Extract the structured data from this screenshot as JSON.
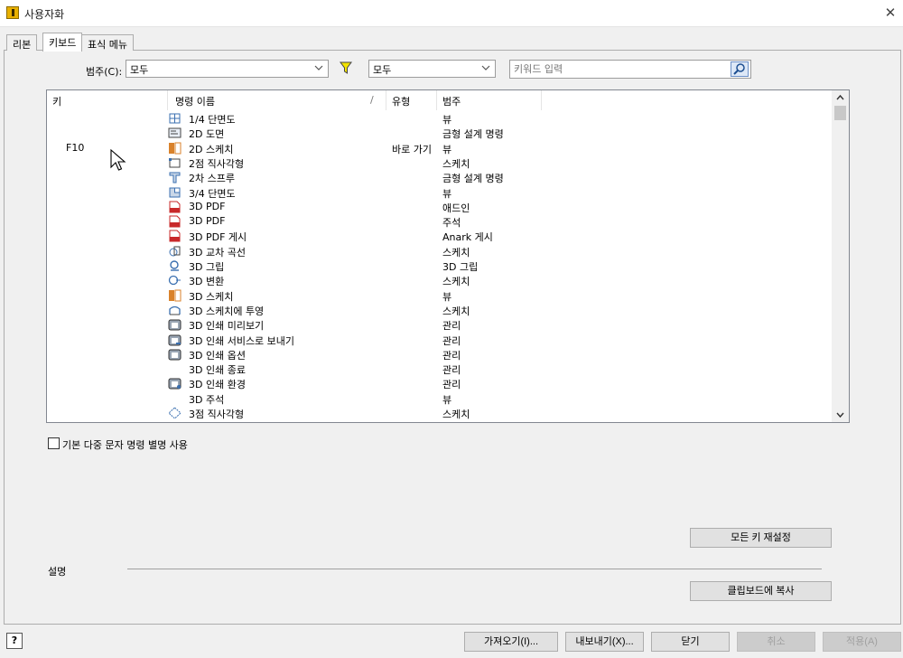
{
  "window": {
    "title": "사용자화"
  },
  "tabs": [
    {
      "label": "리본"
    },
    {
      "label": "키보드"
    },
    {
      "label": "표식 메뉴"
    }
  ],
  "filters": {
    "category_label": "범주(C):",
    "category_value": "모두",
    "filter_value": "모두",
    "search_placeholder": "키워드 입력"
  },
  "list": {
    "columns": [
      "키",
      "명령 이름",
      "/",
      "유형",
      "범주"
    ],
    "rows": [
      {
        "key": "",
        "command": "1/4 단면도",
        "type": "",
        "category": "뷰",
        "icon": "quarter-section-icon"
      },
      {
        "key": "",
        "command": "2D 도면",
        "type": "",
        "category": "금형 설계 명령",
        "icon": "2d-drawing-icon"
      },
      {
        "key": "F10",
        "command": "2D 스케치",
        "type": "바로 가기",
        "category": "뷰",
        "icon": "2d-sketch-icon"
      },
      {
        "key": "",
        "command": "2점 직사각형",
        "type": "",
        "category": "스케치",
        "icon": "two-point-rectangle-icon"
      },
      {
        "key": "",
        "command": "2차 스프루",
        "type": "",
        "category": "금형 설계 명령",
        "icon": "secondary-sprue-icon"
      },
      {
        "key": "",
        "command": "3/4 단면도",
        "type": "",
        "category": "뷰",
        "icon": "three-quarter-section-icon"
      },
      {
        "key": "",
        "command": "3D PDF",
        "type": "",
        "category": "애드인",
        "icon": "pdf-icon"
      },
      {
        "key": "",
        "command": "3D PDF",
        "type": "",
        "category": "주석",
        "icon": "pdf-icon"
      },
      {
        "key": "",
        "command": "3D PDF 게시",
        "type": "",
        "category": "Anark 게시",
        "icon": "pdf-publish-icon"
      },
      {
        "key": "",
        "command": "3D 교차 곡선",
        "type": "",
        "category": "스케치",
        "icon": "intersection-curve-icon"
      },
      {
        "key": "",
        "command": "3D 그립",
        "type": "",
        "category": "3D 그립",
        "icon": "3d-grip-icon"
      },
      {
        "key": "",
        "command": "3D 변환",
        "type": "",
        "category": "스케치",
        "icon": "3d-transform-icon"
      },
      {
        "key": "",
        "command": "3D 스케치",
        "type": "",
        "category": "뷰",
        "icon": "3d-sketch-icon"
      },
      {
        "key": "",
        "command": "3D 스케치에 투영",
        "type": "",
        "category": "스케치",
        "icon": "project-to-3d-sketch-icon"
      },
      {
        "key": "",
        "command": "3D 인쇄 미리보기",
        "type": "",
        "category": "관리",
        "icon": "3d-print-preview-icon"
      },
      {
        "key": "",
        "command": "3D 인쇄 서비스로 보내기",
        "type": "",
        "category": "관리",
        "icon": "3d-print-send-icon"
      },
      {
        "key": "",
        "command": "3D 인쇄 옵션",
        "type": "",
        "category": "관리",
        "icon": "3d-print-options-icon"
      },
      {
        "key": "",
        "command": "3D 인쇄 종료",
        "type": "",
        "category": "관리",
        "icon": ""
      },
      {
        "key": "",
        "command": "3D 인쇄 환경",
        "type": "",
        "category": "관리",
        "icon": "3d-print-env-icon"
      },
      {
        "key": "",
        "command": "3D 주석",
        "type": "",
        "category": "뷰",
        "icon": ""
      },
      {
        "key": "",
        "command": "3점 직사각형",
        "type": "",
        "category": "스케치",
        "icon": "three-point-rectangle-icon"
      }
    ]
  },
  "checkbox": {
    "label": "기본 다중 문자 명령 별명 사용"
  },
  "buttons": {
    "reset_all": "모든 키 재설정",
    "copy_clipboard": "클립보드에 복사",
    "import": "가져오기(I)...",
    "export": "내보내기(X)...",
    "close": "닫기",
    "cancel": "취소",
    "apply": "적용(A)",
    "help": "?"
  },
  "description": {
    "label": "설명"
  },
  "colors": {
    "accent": "#e8b000",
    "filter_funnel": "#d4c000",
    "pdf_red": "#c8282a",
    "icon_blue": "#3a6fb0",
    "sketch_orange": "#d9822b"
  }
}
